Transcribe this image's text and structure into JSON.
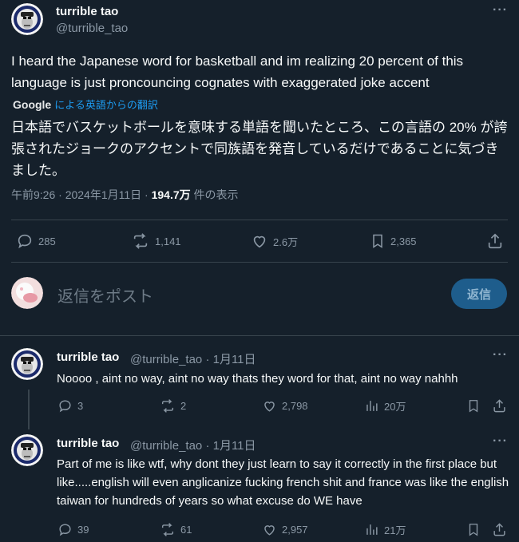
{
  "main": {
    "name": "turrible tao",
    "handle": "@turrible_tao",
    "more": "···",
    "text": "I heard the Japanese word for basketball and im realizing 20 percent of this language is just proncouncing cognates with exaggerated joke accent",
    "translate_brand": "Google",
    "translate_label": "による英語からの翻訳",
    "translation": "日本語でバスケットボールを意味する単語を聞いたところ、この言語の 20% が誇張されたジョークのアクセントで同族語を発音しているだけであることに気づきました。",
    "meta_time": "午前9:26 · 2024年1月11日 · ",
    "meta_views": "194.7万",
    "meta_views_label": " 件の表示",
    "replies": "285",
    "reposts": "1,141",
    "likes": "2.6万",
    "bookmarks": "2,365"
  },
  "composer": {
    "placeholder": "返信をポスト",
    "button": "返信"
  },
  "replies": [
    {
      "name": "turrible tao",
      "handle": "@turrible_tao · 1月11日",
      "text": "Noooo , aint no way, aint no way thats they word for that, aint no way nahhh",
      "replies": "3",
      "reposts": "2",
      "likes": "2,798",
      "views": "20万"
    },
    {
      "name": "turrible tao",
      "handle": "@turrible_tao · 1月11日",
      "text": "Part of me is like wtf, why dont they just learn to say it correctly in the first place but like.....english will even anglicanize fucking french shit and france was like the english taiwan for hundreds of years so what excuse do WE have",
      "replies": "39",
      "reposts": "61",
      "likes": "2,957",
      "views": "21万"
    }
  ],
  "colors": {
    "background": "#15202b",
    "accent": "#1d9bf0",
    "muted": "#8b98a5",
    "divider": "#38444d"
  }
}
